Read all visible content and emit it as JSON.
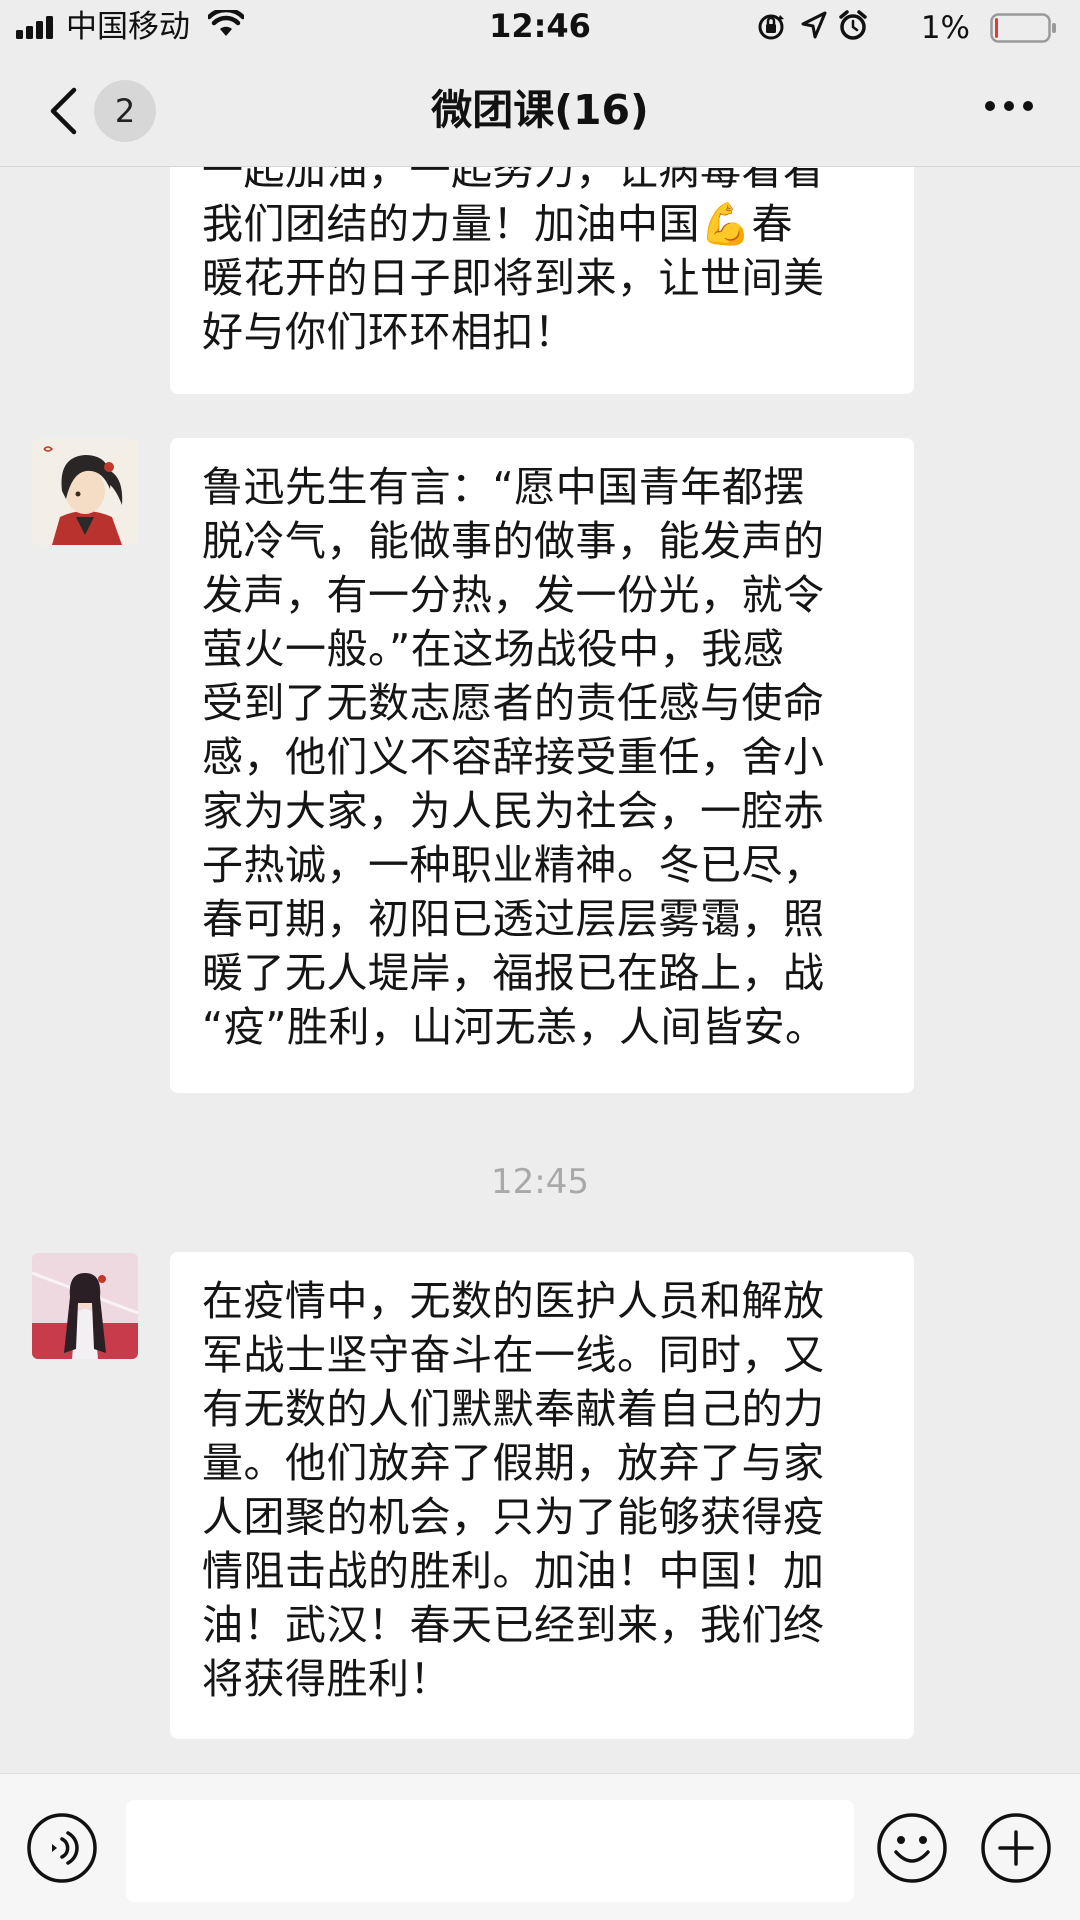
{
  "status_bar": {
    "carrier": "中国移动",
    "time": "12:46",
    "battery_percent": "1%",
    "battery_level": 0.02,
    "icons": [
      "signal-icon",
      "wifi-icon",
      "orientation-lock-icon",
      "location-icon",
      "alarm-icon",
      "battery-icon"
    ]
  },
  "nav": {
    "back_icon": "chevron-left-icon",
    "unread_count": "2",
    "title": "微团课(16)",
    "more_icon": "more-icon"
  },
  "messages": [
    {
      "partial": true,
      "lines": [
        "一起加油，一起努力，让病毒看看",
        "我们团结的力量！加油中国💪春",
        "暖花开的日子即将到来，让世间美",
        "好与你们环环相扣！"
      ]
    },
    {
      "avatar": "avatar-anime-boy",
      "lines": [
        "鲁迅先生有言：“愿中国青年都摆",
        "脱冷气，能做事的做事，能发声的",
        "发声，有一分热，发一份光，就令",
        "萤火一般。”在这场战役中，我感",
        "受到了无数志愿者的责任感与使命",
        "感，他们义不容辞接受重任，舍小",
        "家为大家，为人民为社会，一腔赤",
        "子热诚，一种职业精神。冬已尽，",
        "春可期，初阳已透过层层雾霭，照",
        "暖了无人堤岸，福报已在路上，战",
        "“疫”胜利，山河无恙，人间皆安。"
      ]
    },
    {
      "avatar": "avatar-anime-girl",
      "lines": [
        "在疫情中，无数的医护人员和解放",
        "军战士坚守奋斗在一线。同时，又",
        "有无数的人们默默奉献着自己的力",
        "量。他们放弃了假期，放弃了与家",
        "人团聚的机会，只为了能够获得疫",
        "情阻击战的胜利。加油！中国！加",
        "油！武汉！春天已经到来，我们终",
        "将获得胜利！"
      ]
    }
  ],
  "timestamp": "12:45",
  "input_bar": {
    "voice_icon": "voice-icon",
    "input_value": "",
    "emoji_icon": "emoji-icon",
    "plus_icon": "plus-icon"
  },
  "colors": {
    "background": "#ededed",
    "bubble": "#ffffff",
    "timestamp": "#a9a9a9",
    "battery_low": "#e53935"
  }
}
